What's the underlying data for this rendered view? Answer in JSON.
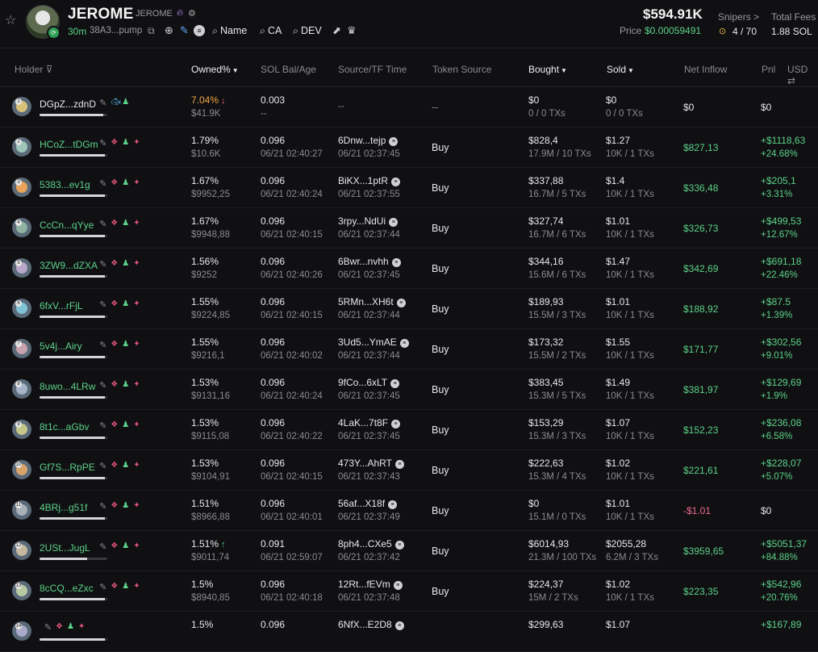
{
  "token": {
    "name": "JEROME",
    "ticker": "JEROME",
    "age": "30m",
    "address": "38A3...pump",
    "links": {
      "name": "Name",
      "ca": "CA",
      "dev": "DEV"
    }
  },
  "stats": {
    "market_cap": "$594.91K",
    "price_label": "Price",
    "price": "$0.00059491",
    "snipers_label": "Snipers >",
    "snipers_value": "4 / 70",
    "fees_label": "Total Fees",
    "fees_value": "1.88 SOL"
  },
  "columns": {
    "holder": "Holder",
    "owned": "Owned%",
    "sol_bal": "SOL Bal/Age",
    "source": "Source/TF Time",
    "token_source": "Token Source",
    "bought": "Bought",
    "sold": "Sold",
    "net_inflow": "Net Inflow",
    "pnl": "Pnl",
    "currency": "USD"
  },
  "colors": {
    "green": "#5cd18a",
    "red": "#f06a8f",
    "orange": "#f0a64a",
    "bg": "#101012"
  },
  "rows": [
    {
      "rank": "1",
      "holder": "DGpZ...zdnD",
      "owned": "7.04%",
      "owned_usd": "$41.9K",
      "sol": "0.003",
      "age": "--",
      "source": "",
      "tf_time": "--",
      "token_source": "--",
      "bought": "$0",
      "bought_sub": "0 / 0 TXs",
      "sold": "$0",
      "sold_sub": "0 / 0 TXs",
      "net_inflow": "$0",
      "pnl": "$0",
      "pnl_pct": "",
      "bar": 0.94
    },
    {
      "rank": "2",
      "holder": "HCoZ...tDGm",
      "owned": "1.79%",
      "owned_usd": "$10.6K",
      "sol": "0.096",
      "age": "06/21 02:40:27",
      "source": "6Dnw...tejp",
      "tf_time": "06/21 02:37:45",
      "token_source": "Buy",
      "bought": "$828,4",
      "bought_sub": "17.9M / 10 TXs",
      "sold": "$1.27",
      "sold_sub": "10K / 1 TXs",
      "net_inflow": "$827,13",
      "pnl": "+$1118,63",
      "pnl_pct": "+24.68%",
      "bar": 0.96
    },
    {
      "rank": "3",
      "holder": "5383...ev1g",
      "owned": "1.67%",
      "owned_usd": "$9952,25",
      "sol": "0.096",
      "age": "06/21 02:40:24",
      "source": "BiKX...1ptR",
      "tf_time": "06/21 02:37:55",
      "token_source": "Buy",
      "bought": "$337,88",
      "bought_sub": "16.7M / 5 TXs",
      "sold": "$1.4",
      "sold_sub": "10K / 1 TXs",
      "net_inflow": "$336,48",
      "pnl": "+$205,1",
      "pnl_pct": "+3.31%",
      "bar": 0.96
    },
    {
      "rank": "4",
      "holder": "CcCn...qYye",
      "owned": "1.67%",
      "owned_usd": "$9948,88",
      "sol": "0.096",
      "age": "06/21 02:40:15",
      "source": "3rpy...NdUi",
      "tf_time": "06/21 02:37:44",
      "token_source": "Buy",
      "bought": "$327,74",
      "bought_sub": "16.7M / 6 TXs",
      "sold": "$1.01",
      "sold_sub": "10K / 1 TXs",
      "net_inflow": "$326,73",
      "pnl": "+$499,53",
      "pnl_pct": "+12.67%",
      "bar": 0.96
    },
    {
      "rank": "5",
      "holder": "3ZW9...dZXA",
      "owned": "1.56%",
      "owned_usd": "$9252",
      "sol": "0.096",
      "age": "06/21 02:40:26",
      "source": "6Bwr...nvhh",
      "tf_time": "06/21 02:37:45",
      "token_source": "Buy",
      "bought": "$344,16",
      "bought_sub": "15.6M / 6 TXs",
      "sold": "$1.47",
      "sold_sub": "10K / 1 TXs",
      "net_inflow": "$342,69",
      "pnl": "+$691,18",
      "pnl_pct": "+22.46%",
      "bar": 0.96
    },
    {
      "rank": "6",
      "holder": "6fxV...rFjL",
      "owned": "1.55%",
      "owned_usd": "$9224,85",
      "sol": "0.096",
      "age": "06/21 02:40:15",
      "source": "5RMn...XH6t",
      "tf_time": "06/21 02:37:44",
      "token_source": "Buy",
      "bought": "$189,93",
      "bought_sub": "15.5M / 3 TXs",
      "sold": "$1.01",
      "sold_sub": "10K / 1 TXs",
      "net_inflow": "$188,92",
      "pnl": "+$87.5",
      "pnl_pct": "+1.39%",
      "bar": 0.96
    },
    {
      "rank": "7",
      "holder": "5v4j...Airy",
      "owned": "1.55%",
      "owned_usd": "$9216,1",
      "sol": "0.096",
      "age": "06/21 02:40:02",
      "source": "3Ud5...YmAE",
      "tf_time": "06/21 02:37:44",
      "token_source": "Buy",
      "bought": "$173,32",
      "bought_sub": "15.5M / 2 TXs",
      "sold": "$1.55",
      "sold_sub": "10K / 1 TXs",
      "net_inflow": "$171,77",
      "pnl": "+$302,56",
      "pnl_pct": "+9.01%",
      "bar": 0.96
    },
    {
      "rank": "8",
      "holder": "8uwo...4LRw",
      "owned": "1.53%",
      "owned_usd": "$9131,16",
      "sol": "0.096",
      "age": "06/21 02:40:24",
      "source": "9fCo...6xLT",
      "tf_time": "06/21 02:37:45",
      "token_source": "Buy",
      "bought": "$383,45",
      "bought_sub": "15.3M / 5 TXs",
      "sold": "$1.49",
      "sold_sub": "10K / 1 TXs",
      "net_inflow": "$381,97",
      "pnl": "+$129,69",
      "pnl_pct": "+1.9%",
      "bar": 0.96
    },
    {
      "rank": "9",
      "holder": "8t1c...aGbv",
      "owned": "1.53%",
      "owned_usd": "$9115,08",
      "sol": "0.096",
      "age": "06/21 02:40:22",
      "source": "4LaK...7t8F",
      "tf_time": "06/21 02:37:45",
      "token_source": "Buy",
      "bought": "$153,29",
      "bought_sub": "15.3M / 3 TXs",
      "sold": "$1.07",
      "sold_sub": "10K / 1 TXs",
      "net_inflow": "$152,23",
      "pnl": "+$236,08",
      "pnl_pct": "+6.58%",
      "bar": 0.96
    },
    {
      "rank": "10",
      "holder": "Gf7S...RpPE",
      "owned": "1.53%",
      "owned_usd": "$9104,91",
      "sol": "0.096",
      "age": "06/21 02:40:15",
      "source": "473Y...AhRT",
      "tf_time": "06/21 02:37:43",
      "token_source": "Buy",
      "bought": "$222,63",
      "bought_sub": "15.3M / 4 TXs",
      "sold": "$1.02",
      "sold_sub": "10K / 1 TXs",
      "net_inflow": "$221,61",
      "pnl": "+$228,07",
      "pnl_pct": "+5.07%",
      "bar": 0.96
    },
    {
      "rank": "11",
      "holder": "4BRj...g51f",
      "owned": "1.51%",
      "owned_usd": "$8966,88",
      "sol": "0.096",
      "age": "06/21 02:40:01",
      "source": "56af...X18f",
      "tf_time": "06/21 02:37:49",
      "token_source": "Buy",
      "bought": "$0",
      "bought_sub": "15.1M / 0 TXs",
      "sold": "$1.01",
      "sold_sub": "10K / 1 TXs",
      "net_inflow": "-$1.01",
      "pnl": "$0",
      "pnl_pct": "",
      "bar": 0.96
    },
    {
      "rank": "12",
      "holder": "2USt...JugL",
      "owned": "1.51%",
      "owned_usd": "$9011,74",
      "sol": "0.091",
      "age": "06/21 02:59:07",
      "source": "8ph4...CXe5",
      "tf_time": "06/21 02:37:42",
      "token_source": "Buy",
      "bought": "$6014,93",
      "bought_sub": "21.3M / 100 TXs",
      "sold": "$2055,28",
      "sold_sub": "6.2M / 3 TXs",
      "net_inflow": "$3959,65",
      "pnl": "+$5051,37",
      "pnl_pct": "+84.88%",
      "bar": 0.7
    },
    {
      "rank": "13",
      "holder": "8cCQ...eZxc",
      "owned": "1.5%",
      "owned_usd": "$8940,85",
      "sol": "0.096",
      "age": "06/21 02:40:18",
      "source": "12Rt...fEVm",
      "tf_time": "06/21 02:37:48",
      "token_source": "Buy",
      "bought": "$224,37",
      "bought_sub": "15M / 2 TXs",
      "sold": "$1.02",
      "sold_sub": "10K / 1 TXs",
      "net_inflow": "$223,35",
      "pnl": "+$542,96",
      "pnl_pct": "+20.76%",
      "bar": 0.96
    },
    {
      "rank": "14",
      "holder": "",
      "owned": "1.5%",
      "owned_usd": "",
      "sol": "0.096",
      "age": "",
      "source": "6NfX...E2D8",
      "tf_time": "",
      "token_source": "",
      "bought": "$299,63",
      "bought_sub": "",
      "sold": "$1.07",
      "sold_sub": "",
      "net_inflow": "",
      "pnl": "+$167,89",
      "pnl_pct": "",
      "bar": 0.96
    }
  ]
}
